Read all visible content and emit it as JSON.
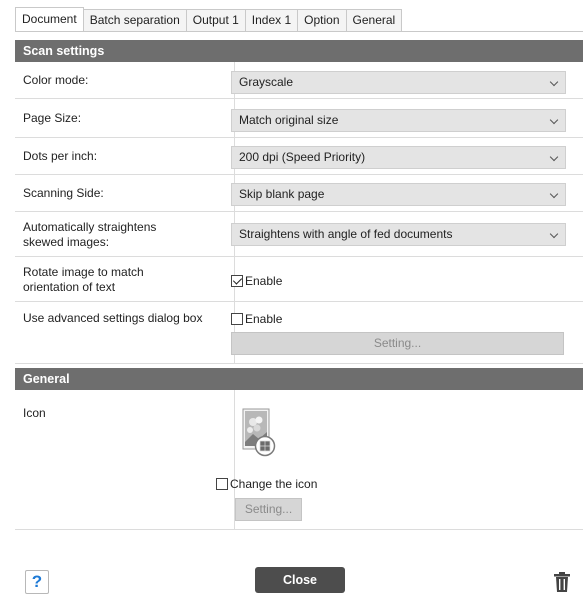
{
  "tabs": [
    "Document",
    "Batch separation",
    "Output 1",
    "Index 1",
    "Option",
    "General"
  ],
  "scan_settings": {
    "header": "Scan settings",
    "color_mode": {
      "label": "Color mode:",
      "value": "Grayscale"
    },
    "page_size": {
      "label": "Page Size:",
      "value": "Match original size"
    },
    "dpi": {
      "label": "Dots per inch:",
      "value": "200 dpi (Speed Priority)"
    },
    "scanning_side": {
      "label": "Scanning Side:",
      "value": "Skip blank page"
    },
    "straighten": {
      "label": "Automatically straightens skewed images:",
      "value": "Straightens with angle of fed documents"
    },
    "rotate": {
      "label": "Rotate image to match orientation of text",
      "checkbox": "Enable",
      "checked": true
    },
    "advanced": {
      "label": "Use advanced settings dialog box",
      "checkbox": "Enable",
      "checked": false,
      "button": "Setting..."
    }
  },
  "general": {
    "header": "General",
    "icon_label": "Icon",
    "change_icon": {
      "label": "Change the icon",
      "checked": false
    },
    "button": "Setting..."
  },
  "footer": {
    "help": "?",
    "close": "Close"
  },
  "icons": [
    "question-icon",
    "trash-icon",
    "document-icon",
    "chevron-down-icon"
  ],
  "colors": {
    "section_header": "#6e6e6e",
    "close_button": "#4d4d4d",
    "help_accent": "#1e7ad6"
  }
}
